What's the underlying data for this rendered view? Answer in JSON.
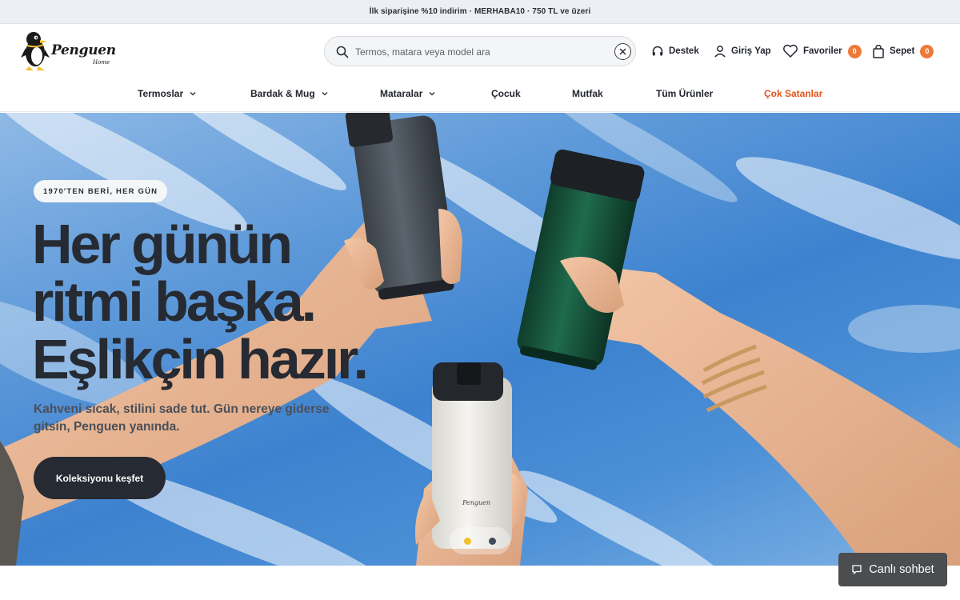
{
  "announcement": "İlk siparişine %10 indirim · MERHABA10 · 750 TL ve üzeri",
  "brand": {
    "name": "Penguen",
    "sub": "Home"
  },
  "search": {
    "placeholder": "Termos, matara veya model ara",
    "icon": "search-icon",
    "clear_icon": "close-icon"
  },
  "header_actions": {
    "support": {
      "label": "Destek",
      "icon": "headset-icon"
    },
    "login": {
      "label": "Giriş Yap",
      "icon": "user-icon"
    },
    "favorites": {
      "label": "Favoriler",
      "count": "0",
      "icon": "heart-icon"
    },
    "cart": {
      "label": "Sepet",
      "count": "0",
      "icon": "shopping-bag-icon"
    }
  },
  "nav": [
    {
      "label": "Termoslar",
      "has_dropdown": true
    },
    {
      "label": "Bardak & Mug",
      "has_dropdown": true
    },
    {
      "label": "Mataralar",
      "has_dropdown": true
    },
    {
      "label": "Çocuk",
      "has_dropdown": false
    },
    {
      "label": "Mutfak",
      "has_dropdown": false
    },
    {
      "label": "Tüm Ürünler",
      "has_dropdown": false
    },
    {
      "label": "Çok Satanlar",
      "has_dropdown": false,
      "highlight": "#e4541d"
    }
  ],
  "hero": {
    "eyebrow": "1970'TEN BERİ, HER GÜN",
    "headline": [
      "Her günün",
      "ritmi başka.",
      "Eşlikçin hazır."
    ],
    "subcopy": "Kahveni sıcak, stilini sade tut. Gün nereye giderse gitsin, Penguen yanında.",
    "cta": "Koleksiyonu keşfet",
    "slides": 2,
    "active_slide": 1,
    "mug_logo_text": "Penguen"
  },
  "chat": {
    "label": "Canlı sohbet",
    "icon": "chat-bubble-icon"
  },
  "colors": {
    "accent": "#ee7a38",
    "hot": "#e4541d",
    "dark": "#262a32",
    "dot_active": "#f2c12e"
  }
}
